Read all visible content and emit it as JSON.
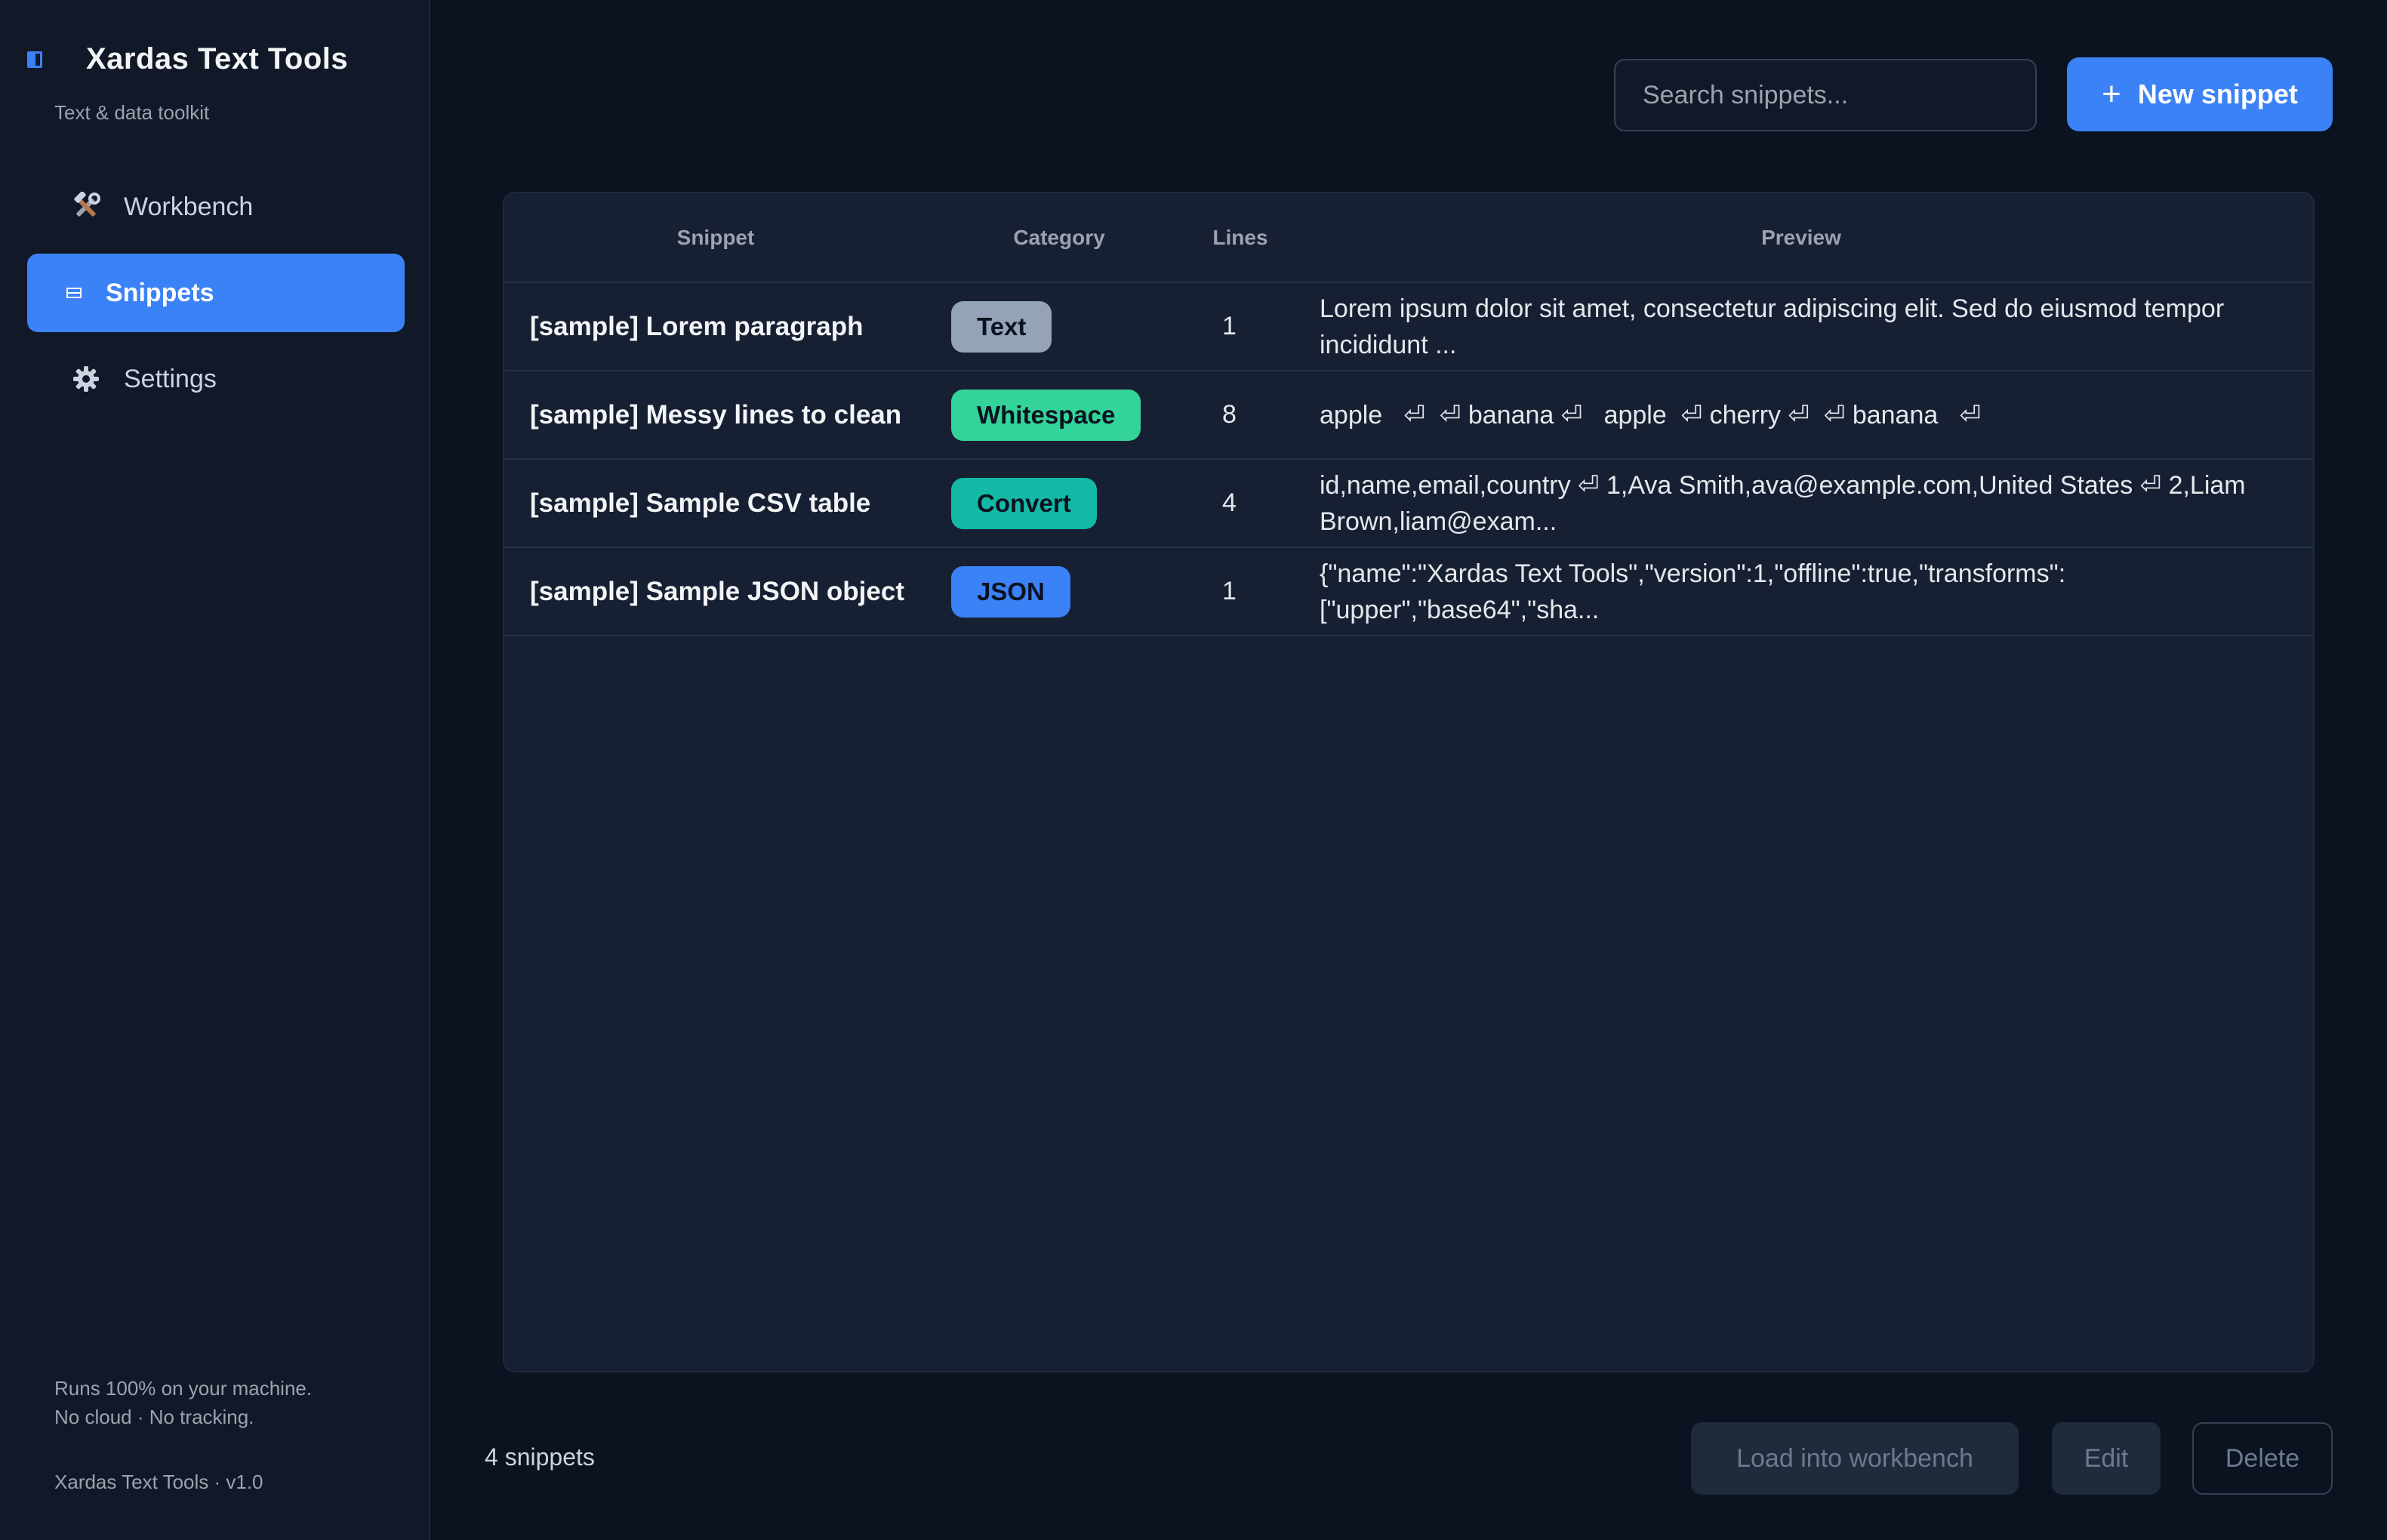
{
  "sidebar": {
    "title": "Xardas Text Tools",
    "subtitle": "Text & data toolkit",
    "items": [
      {
        "label": "Workbench",
        "icon": "hammer-wrench-icon"
      },
      {
        "label": "Snippets",
        "icon": "snippets-icon",
        "active": true
      },
      {
        "label": "Settings",
        "icon": "gear-icon"
      }
    ],
    "footer_line1": "Runs 100% on your machine.",
    "footer_line2": "No cloud · No tracking.",
    "version": "Xardas Text Tools · v1.0"
  },
  "header": {
    "search_placeholder": "Search snippets...",
    "new_button_plus": "+",
    "new_button_label": "New snippet"
  },
  "table": {
    "columns": [
      "Snippet",
      "Category",
      "Lines",
      "Preview"
    ],
    "rows": [
      {
        "name": "[sample] Lorem paragraph",
        "category": "Text",
        "lines": "1",
        "preview": "Lorem ipsum dolor sit amet, consectetur adipiscing elit. Sed do eiusmod tempor incididunt ..."
      },
      {
        "name": "[sample] Messy lines to clean",
        "category": "Whitespace",
        "lines": "8",
        "preview": "apple   ⏎  ⏎ banana ⏎   apple  ⏎ cherry ⏎  ⏎ banana   ⏎"
      },
      {
        "name": "[sample] Sample CSV table",
        "category": "Convert",
        "lines": "4",
        "preview": "id,name,email,country ⏎ 1,Ava Smith,ava@example.com,United States ⏎ 2,Liam Brown,liam@exam..."
      },
      {
        "name": "[sample] Sample JSON object",
        "category": "JSON",
        "lines": "1",
        "preview": "{\"name\":\"Xardas Text Tools\",\"version\":1,\"offline\":true,\"transforms\":[\"upper\",\"base64\",\"sha..."
      }
    ]
  },
  "footer": {
    "count": "4 snippets",
    "load_label": "Load into workbench",
    "edit_label": "Edit",
    "delete_label": "Delete"
  },
  "colors": {
    "accent": "#3b82f6",
    "text_pill": "#94a3b8",
    "whitespace_pill": "#34d399",
    "convert_pill": "#14b8a6",
    "json_pill": "#3b82f6"
  }
}
